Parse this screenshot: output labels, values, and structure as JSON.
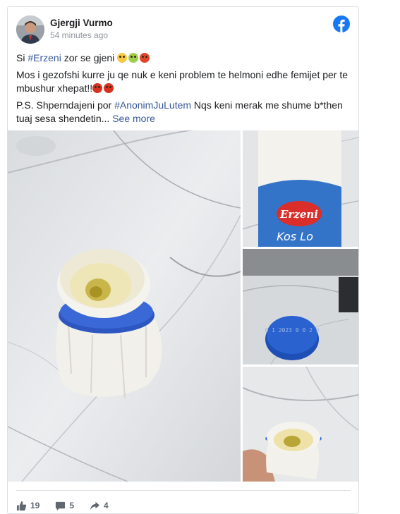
{
  "post": {
    "author": "Gjergji Vurmo",
    "time": "54 minutes ago",
    "line1_prefix": "Si ",
    "line1_hashtag": "#Erzeni",
    "line1_suffix": " zor se gjeni ",
    "line2": "Mos i gezofshi kurre ju qe nuk e keni problem te helmoni edhe femijet per te mbushur xhepat!!",
    "line3_prefix": "P.S. Shperndajeni por ",
    "line3_hashtag": "#AnonimJuLutem",
    "line3_suffix": " Nqs keni merak me shume b*then tuaj sesa shendetin",
    "ellipsis": "... ",
    "see_more": "See more"
  },
  "photos": {
    "label_brand": "Erzeni",
    "label_product": "Kos Lo",
    "cap_text": "0 1 2023 0 0 2 3"
  },
  "stats": {
    "likes": "19",
    "comments": "5",
    "shares": "4"
  },
  "icons": {
    "facebook": "facebook-logo-icon",
    "like": "thumbs-up-icon",
    "comment": "comment-bubble-icon",
    "share": "share-arrow-icon"
  },
  "colors": {
    "facebook_blue": "#1877f2",
    "link": "#385898",
    "muted": "#90949c"
  }
}
